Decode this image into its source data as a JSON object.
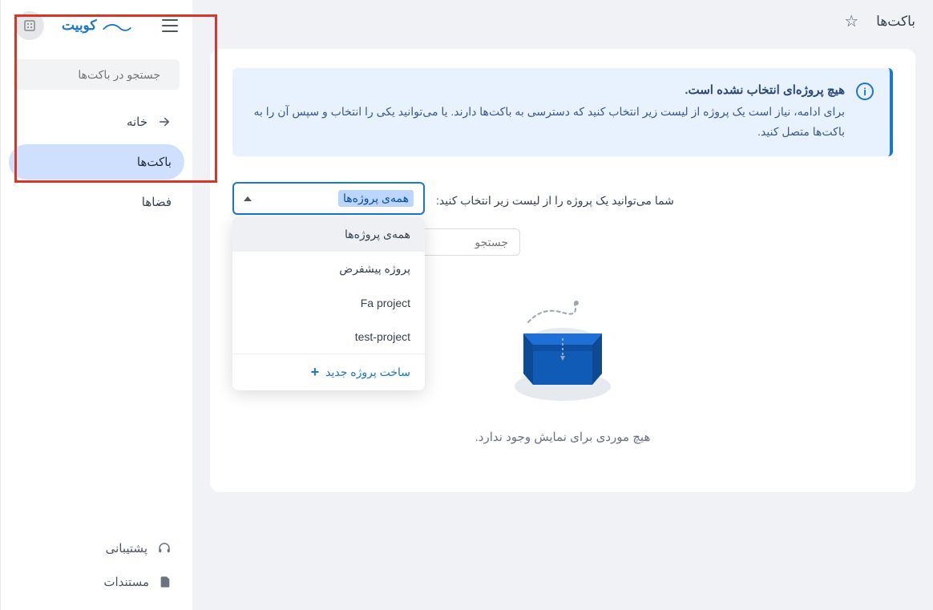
{
  "brand": {
    "name": "کوبیت"
  },
  "sidebar": {
    "search_placeholder": "جستجو در باکت‌ها",
    "items": [
      {
        "label": "خانه"
      },
      {
        "label": "باکت‌ها"
      },
      {
        "label": "فضاها"
      }
    ],
    "bottom": [
      {
        "label": "پشتیبانی"
      },
      {
        "label": "مستندات"
      }
    ]
  },
  "header": {
    "title": "باکت‌ها"
  },
  "alert": {
    "title": "هیچ پروژه‌ای انتخاب نشده است.",
    "text": "برای ادامه، نیاز است یک پروژه از لیست زیر انتخاب کنید که دسترسی به باکت‌ها دارند. یا می‌توانید یکی را انتخاب و سپس آن را به باکت‌ها متصل کنید."
  },
  "select": {
    "current": "همه‌ی پروژه‌ها",
    "options": [
      "همه‌ی پروژه‌ها",
      "پروژه پیشفرض",
      "Fa project",
      "test-project"
    ],
    "new_label": "ساخت پروژه جدید"
  },
  "hint": "شما می‌توانید یک پروژه را از لیست زیر انتخاب کنید:",
  "search": {
    "placeholder": "جستجو"
  },
  "empty": {
    "text": "هیچ موردی برای نمایش وجود ندارد."
  }
}
